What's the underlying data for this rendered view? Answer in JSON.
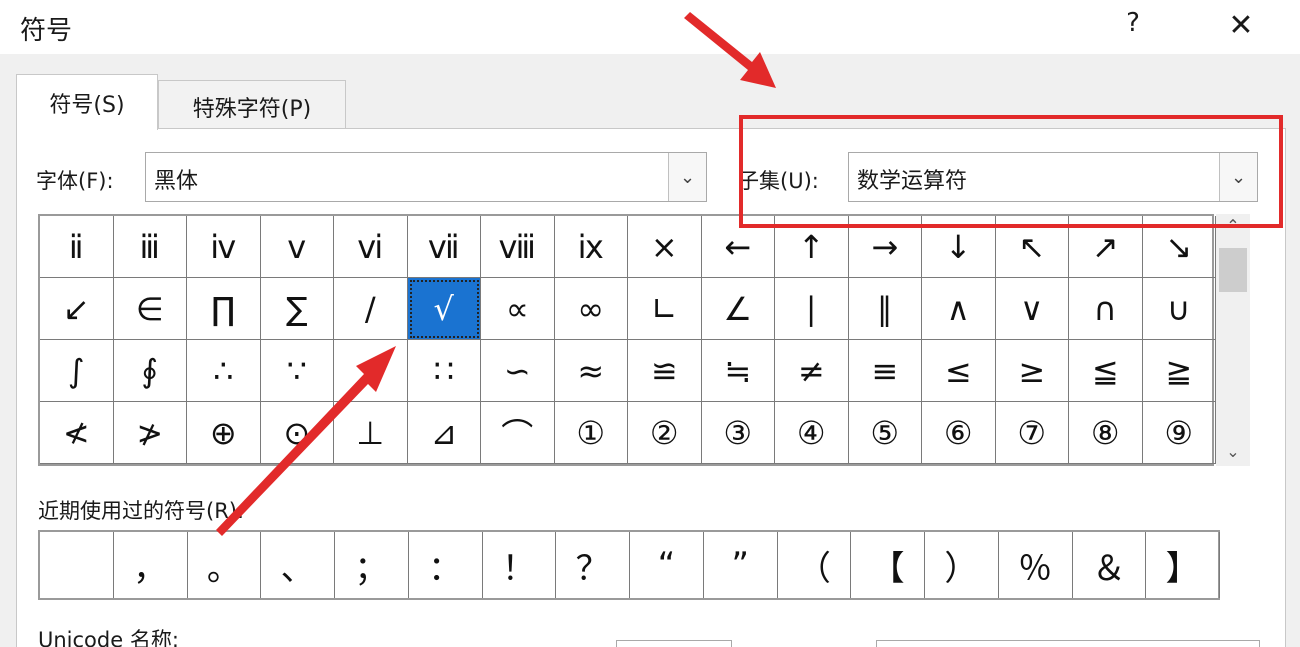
{
  "window": {
    "title": "符号",
    "help_glyph": "?",
    "close_glyph": "✕"
  },
  "tabs": [
    {
      "label": "符号(S)",
      "active": true
    },
    {
      "label": "特殊字符(P)",
      "active": false
    }
  ],
  "font": {
    "label": "字体(F):",
    "value": "黑体"
  },
  "subset": {
    "label": "子集(U):",
    "value": "数学运算符"
  },
  "symbols": [
    "ⅱ",
    "ⅲ",
    "ⅳ",
    "ⅴ",
    "ⅵ",
    "ⅶ",
    "ⅷ",
    "ⅸ",
    "×",
    "←",
    "↑",
    "→",
    "↓",
    "↖",
    "↗",
    "↘",
    "↙",
    "∈",
    "∏",
    "∑",
    "∕",
    "√",
    "∝",
    "∞",
    "∟",
    "∠",
    "∣",
    "∥",
    "∧",
    "∨",
    "∩",
    "∪",
    "∫",
    "∮",
    "∴",
    "∵",
    "∶",
    "∷",
    "∽",
    "≈",
    "≌",
    "≒",
    "≠",
    "≡",
    "≤",
    "≥",
    "≦",
    "≧",
    "≮",
    "≯",
    "⊕",
    "⊙",
    "⊥",
    "⊿",
    "⌒",
    "①",
    "②",
    "③",
    "④",
    "⑤",
    "⑥",
    "⑦",
    "⑧",
    "⑨"
  ],
  "selected_symbol_index": 21,
  "recent": {
    "label": "近期使用过的符号(R):",
    "symbols": [
      "",
      "，",
      "。",
      "、",
      "；",
      "：",
      "！",
      "？",
      "“",
      "”",
      "（",
      "【",
      "）",
      "％",
      "＆",
      "】"
    ]
  },
  "unicode": {
    "label": "Unicode 名称:"
  },
  "scrollbar": {
    "up_glyph": "⌃",
    "down_glyph": "⌄"
  },
  "annotation": {
    "highlight_color": "#e22a2a"
  }
}
